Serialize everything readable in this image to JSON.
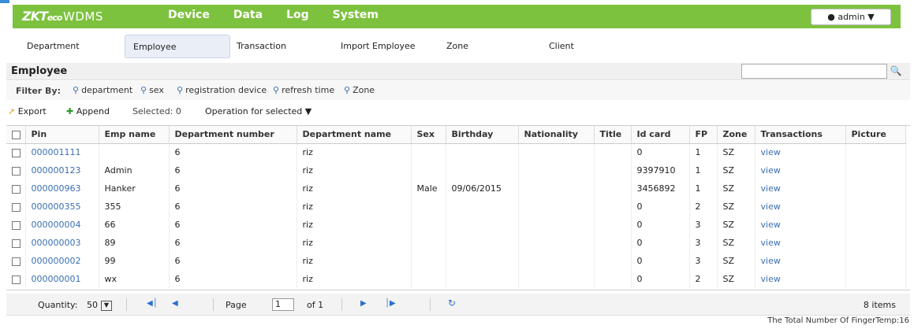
{
  "header": {
    "logo_zk": "ZKT",
    "logo_eco": "eco",
    "app": "WDMS",
    "nav": [
      "Device",
      "Data",
      "Log",
      "System"
    ],
    "user": "admin"
  },
  "subnav": [
    "Department",
    "Employee",
    "Transaction",
    "Import Employee",
    "Zone",
    "Client"
  ],
  "pane": {
    "title": "Employee",
    "search_placeholder": ""
  },
  "filter": {
    "label": "Filter By:",
    "items": [
      "department",
      "sex",
      "registration device",
      "refresh time",
      "Zone"
    ]
  },
  "toolbar": {
    "export": "Export",
    "append": "Append",
    "selected": "Selected: 0",
    "operation": "Operation for selected"
  },
  "columns": [
    "Pin",
    "Emp name",
    "Department number",
    "Department name",
    "Sex",
    "Birthday",
    "Nationality",
    "Title",
    "Id card",
    "FP",
    "Zone",
    "Transactions",
    "Picture"
  ],
  "rows": [
    [
      "000001111",
      "",
      "6",
      "riz",
      "",
      "",
      "",
      "",
      "0",
      "1",
      "SZ",
      "view",
      ""
    ],
    [
      "000000123",
      "Admin",
      "6",
      "riz",
      "",
      "",
      "",
      "",
      "9397910",
      "1",
      "SZ",
      "view",
      ""
    ],
    [
      "000000963",
      "Hanker",
      "6",
      "riz",
      "Male",
      "09/06/2015",
      "",
      "",
      "3456892",
      "1",
      "SZ",
      "view",
      ""
    ],
    [
      "000000355",
      "355",
      "6",
      "riz",
      "",
      "",
      "",
      "",
      "0",
      "2",
      "SZ",
      "view",
      ""
    ],
    [
      "000000004",
      "66",
      "6",
      "riz",
      "",
      "",
      "",
      "",
      "0",
      "3",
      "SZ",
      "view",
      ""
    ],
    [
      "000000003",
      "89",
      "6",
      "riz",
      "",
      "",
      "",
      "",
      "0",
      "3",
      "SZ",
      "view",
      ""
    ],
    [
      "000000002",
      "99",
      "6",
      "riz",
      "",
      "",
      "",
      "",
      "0",
      "3",
      "SZ",
      "view",
      ""
    ],
    [
      "000000001",
      "wx",
      "6",
      "riz",
      "",
      "",
      "",
      "",
      "0",
      "2",
      "SZ",
      "view",
      ""
    ]
  ],
  "pager": {
    "quantity_label": "Quantity:",
    "quantity": "50",
    "page_label": "Page",
    "page": "1",
    "of": "of 1",
    "items": "8 items"
  },
  "footer": "The Total Number Of FingerTemp:16",
  "colors": {
    "header": "#7dc23f",
    "link": "#3a6fb0"
  }
}
